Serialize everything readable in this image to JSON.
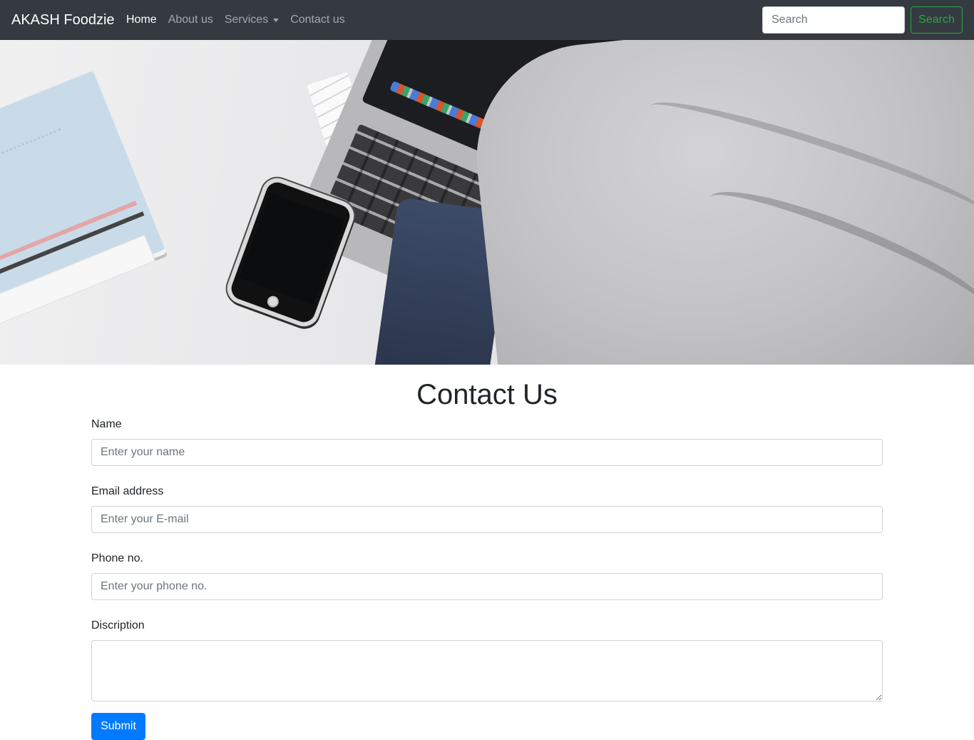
{
  "navbar": {
    "brand": "AKASH Foodzie",
    "links": [
      {
        "label": "Home",
        "active": true
      },
      {
        "label": "About us",
        "active": false
      },
      {
        "label": "Services",
        "active": false,
        "dropdown": true
      },
      {
        "label": "Contact us",
        "active": false
      }
    ],
    "search_placeholder": "Search",
    "search_button": "Search"
  },
  "contact": {
    "title": "Contact Us",
    "fields": {
      "name": {
        "label": "Name",
        "placeholder": "Enter your name"
      },
      "email": {
        "label": "Email address",
        "placeholder": "Enter your E-mail"
      },
      "phone": {
        "label": "Phone no.",
        "placeholder": "Enter your phone no."
      },
      "description": {
        "label": "Discription",
        "placeholder": ""
      }
    },
    "submit_label": "Submit"
  },
  "colors": {
    "navbar_bg": "#343a40",
    "search_btn": "#28a745",
    "submit_btn": "#007bff"
  }
}
